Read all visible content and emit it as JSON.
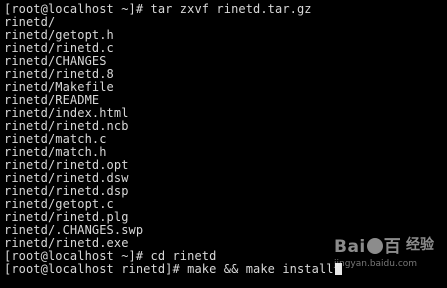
{
  "terminal": {
    "background": "#000000",
    "foreground": "#d8d8d8",
    "lines": [
      "[root@localhost ~]# tar zxvf rinetd.tar.gz",
      "rinetd/",
      "rinetd/getopt.h",
      "rinetd/rinetd.c",
      "rinetd/CHANGES",
      "rinetd/rinetd.8",
      "rinetd/Makefile",
      "rinetd/README",
      "rinetd/index.html",
      "rinetd/rinetd.ncb",
      "rinetd/match.c",
      "rinetd/match.h",
      "rinetd/rinetd.opt",
      "rinetd/rinetd.dsw",
      "rinetd/rinetd.dsp",
      "rinetd/getopt.c",
      "rinetd/rinetd.plg",
      "rinetd/.CHANGES.swp",
      "rinetd/rinetd.exe",
      "[root@localhost ~]# cd rinetd"
    ],
    "current_line": "[root@localhost rinetd]# make && make install"
  },
  "watermark": {
    "logo_left": "Bai",
    "logo_right": "百",
    "brand": "经验",
    "url": "jingyan.baidu.com"
  }
}
